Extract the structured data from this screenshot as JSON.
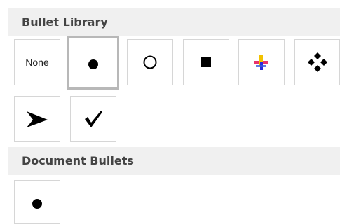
{
  "bullet_library": {
    "header": "Bullet Library",
    "items": [
      {
        "label": "None",
        "icon": "none-text",
        "selected": false
      },
      {
        "label": "",
        "icon": "filled-circle-bullet-icon",
        "selected": true
      },
      {
        "label": "",
        "icon": "hollow-circle-bullet-icon",
        "selected": false
      },
      {
        "label": "",
        "icon": "filled-square-bullet-icon",
        "selected": false
      },
      {
        "label": "",
        "icon": "color-cross-bullet-icon",
        "selected": false
      },
      {
        "label": "",
        "icon": "four-diamond-bullet-icon",
        "selected": false
      },
      {
        "label": "",
        "icon": "arrowhead-bullet-icon",
        "selected": false
      },
      {
        "label": "",
        "icon": "checkmark-bullet-icon",
        "selected": false
      }
    ]
  },
  "document_bullets": {
    "header": "Document Bullets",
    "items": [
      {
        "label": "",
        "icon": "filled-circle-bullet-icon",
        "selected": false
      }
    ]
  },
  "colors": {
    "header_background": "#f0f0f0",
    "header_text": "#444444",
    "tile_border": "#d6d6d6",
    "selected_border": "#b8b8b8"
  }
}
